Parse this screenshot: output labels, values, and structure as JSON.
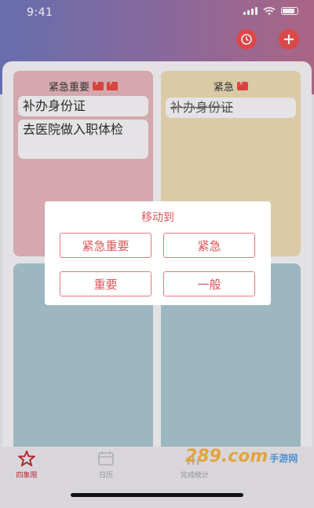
{
  "status": {
    "time": "9:41"
  },
  "header": {
    "timer_icon": "clock-icon",
    "add_icon": "plus-icon",
    "accent": "#ea4b4b"
  },
  "quadrants": [
    {
      "title": "紧急重要",
      "flags": 2,
      "color": "#e3b3b9",
      "tasks": [
        {
          "text": "补办身份证",
          "done": false
        },
        {
          "text": "去医院做入职体检",
          "done": false
        }
      ]
    },
    {
      "title": "紧急",
      "flags": 1,
      "color": "#ead8b0",
      "tasks": [
        {
          "text": "补办身份证",
          "done": true
        }
      ]
    },
    {
      "title": "",
      "color": "#a8c4cc",
      "tasks": []
    },
    {
      "title": "",
      "color": "#a8c4cc",
      "tasks": []
    }
  ],
  "dialog": {
    "title": "移动到",
    "options": [
      "紧急重要",
      "紧急",
      "重要",
      "一般"
    ]
  },
  "tabbar": {
    "tabs": [
      {
        "label": "四象限",
        "icon": "star-icon",
        "active": true
      },
      {
        "label": "日历",
        "icon": "calendar-icon",
        "active": false
      },
      {
        "label": "完成统计",
        "icon": "chart-icon",
        "active": false
      }
    ]
  },
  "watermark": {
    "text": "289.com",
    "sub": "手游网"
  }
}
